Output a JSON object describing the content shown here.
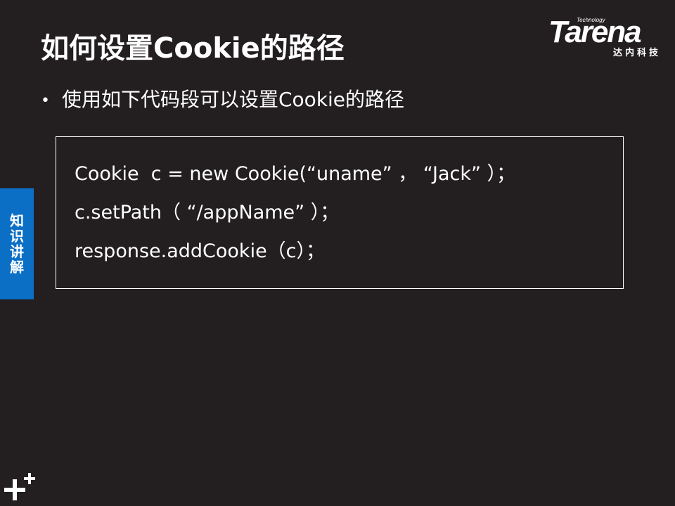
{
  "slide": {
    "title": "如何设置Cookie的路径",
    "bullet": "使用如下代码段可以设置Cookie的路径",
    "code_lines": [
      "Cookie  c = new Cookie(“uname” ， “Jack” ）；",
      "c.setPath（ “/appName” ）；",
      "response.addCookie（c）；"
    ]
  },
  "logo": {
    "tagline": "Technology",
    "brand": "Tarena",
    "subtitle": "达内科技"
  },
  "side_tab": {
    "chars": [
      "知",
      "识",
      "讲",
      "解"
    ]
  },
  "colors": {
    "background": "#231f20",
    "tab_blue": "#0b6fc6",
    "text": "#ffffff"
  },
  "icons": {
    "corner": "plus-icon"
  }
}
